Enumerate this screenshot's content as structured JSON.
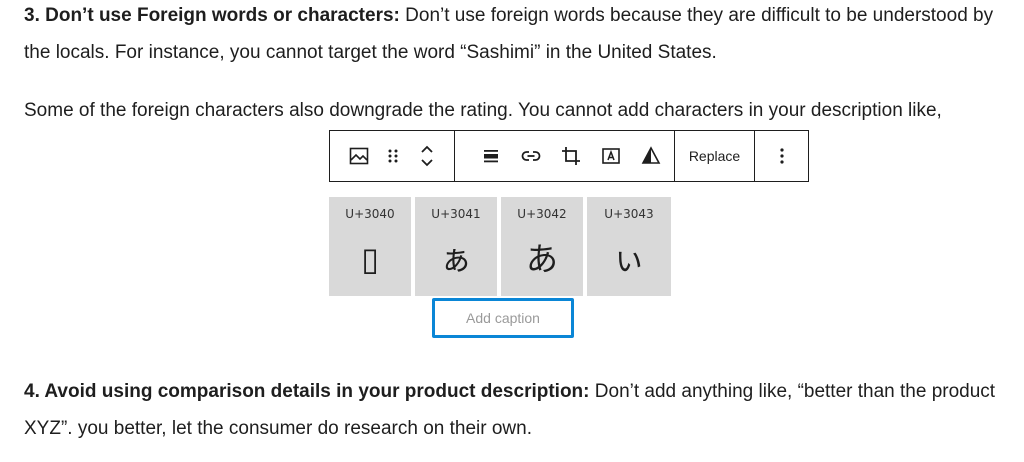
{
  "paragraphs": {
    "p1": {
      "bold": "3. Don’t use Foreign words or characters:",
      "text": " Don’t use foreign words because they are difficult to be understood by the locals. For instance, you cannot target the word “Sashimi” in the United States."
    },
    "p2": {
      "text": "Some of the foreign characters also downgrade the rating. You cannot add characters in your description like,"
    },
    "p3": {
      "bold": "4. Avoid using comparison details in your product description:",
      "text": " Don’t add anything like, “better than the product XYZ”. you better, let the consumer do research on their own."
    }
  },
  "toolbar": {
    "replace_label": "Replace",
    "icons": [
      "image-block-icon",
      "drag-handle-icon",
      "move-up-icon",
      "move-down-icon",
      "align-icon",
      "link-icon",
      "crop-icon",
      "text-overlay-icon",
      "duotone-icon",
      "more-options-icon"
    ]
  },
  "char_table": [
    {
      "code": "U+3040",
      "glyph": "▯"
    },
    {
      "code": "U+3041",
      "glyph": "ぁ"
    },
    {
      "code": "U+3042",
      "glyph": "あ"
    },
    {
      "code": "U+3043",
      "glyph": "ぃ"
    }
  ],
  "caption": {
    "placeholder": "Add caption"
  }
}
